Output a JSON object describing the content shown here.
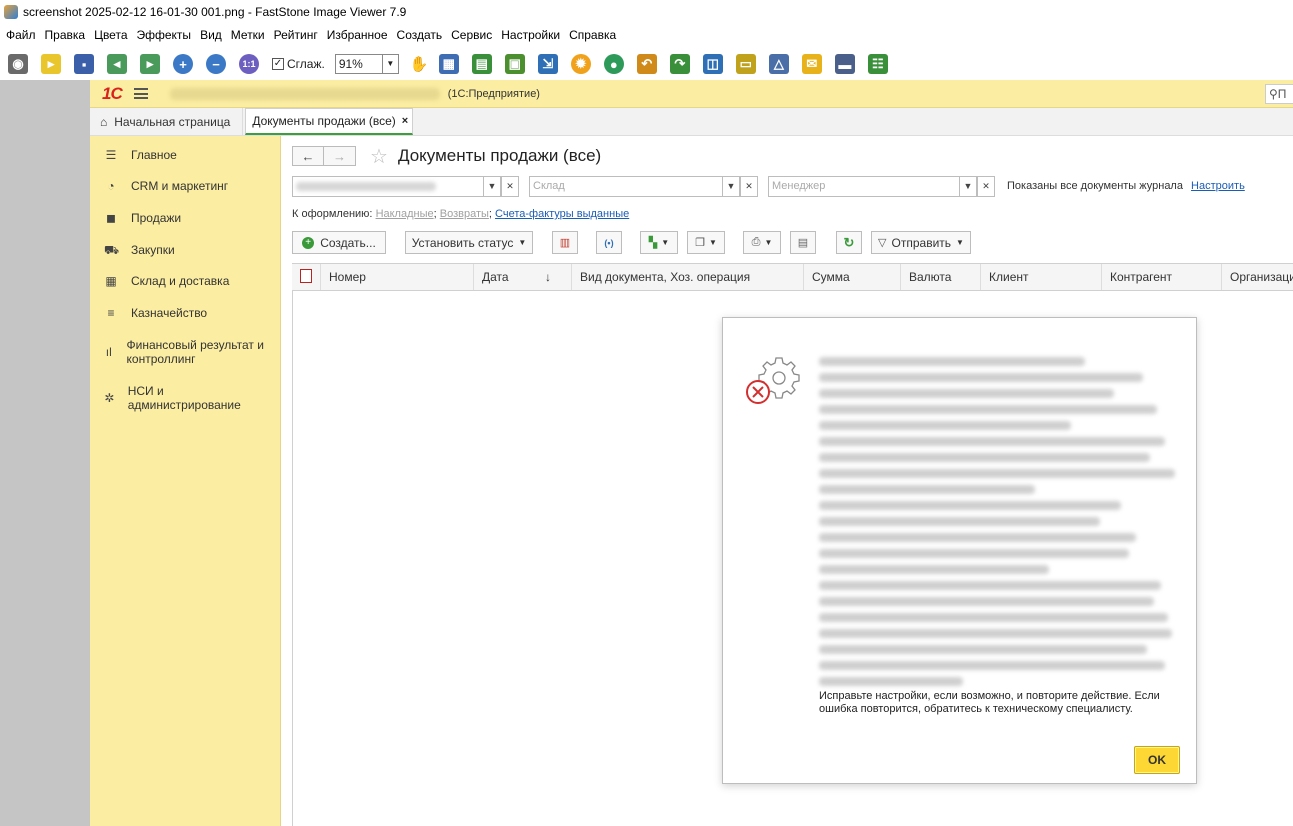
{
  "window": {
    "title": "screenshot 2025-02-12 16-01-30 001.png  -  FastStone Image Viewer 7.9"
  },
  "menu": [
    "Файл",
    "Правка",
    "Цвета",
    "Эффекты",
    "Вид",
    "Метки",
    "Рейтинг",
    "Избранное",
    "Создать",
    "Сервис",
    "Настройки",
    "Справка"
  ],
  "viewer_toolbar": {
    "smooth_label": "Сглаж.",
    "zoom_value": "91%"
  },
  "app": {
    "name": "(1С:Предприятие)",
    "search_label": "П"
  },
  "tabs": {
    "home": "Начальная страница",
    "active": "Документы продажи (все)",
    "close": "×"
  },
  "sidebar": {
    "items": [
      {
        "label": "Главное",
        "icon": "menu-lines-icon"
      },
      {
        "label": "CRM и маркетинг",
        "icon": "pie-icon"
      },
      {
        "label": "Продажи",
        "icon": "bag-icon"
      },
      {
        "label": "Закупки",
        "icon": "cart-icon"
      },
      {
        "label": "Склад и доставка",
        "icon": "warehouse-icon"
      },
      {
        "label": "Казначейство",
        "icon": "coins-icon"
      },
      {
        "label": "Финансовый результат и контроллинг",
        "icon": "bar-chart-icon"
      },
      {
        "label": "НСИ и администрирование",
        "icon": "gear-icon"
      }
    ]
  },
  "page": {
    "title": "Документы продажи (все)",
    "nav_back": "←",
    "nav_forward": "→",
    "star": "☆"
  },
  "filters": {
    "warehouse_placeholder": "Склад",
    "manager_placeholder": "Менеджер",
    "note": "Показаны все документы журнала",
    "configure_link": "Настроить"
  },
  "to_process": {
    "label": "К оформлению:",
    "link1": "Накладные",
    "sep1": ";",
    "link2": "Возвраты",
    "sep2": ";",
    "link3": "Счета-фактуры выданные"
  },
  "commands": {
    "create": "Создать...",
    "set_status": "Установить статус",
    "send": "Отправить"
  },
  "grid": {
    "columns": [
      "Номер",
      "Дата",
      "Вид документа, Хоз. операция",
      "Сумма",
      "Валюта",
      "Клиент",
      "Контрагент",
      "Организаци"
    ],
    "sort_mark": "↓"
  },
  "dialog": {
    "message": "Исправьте настройки, если возможно, и повторите действие. Если ошибка повторится, обратитесь к техническому специалисту.",
    "ok": "OK"
  }
}
